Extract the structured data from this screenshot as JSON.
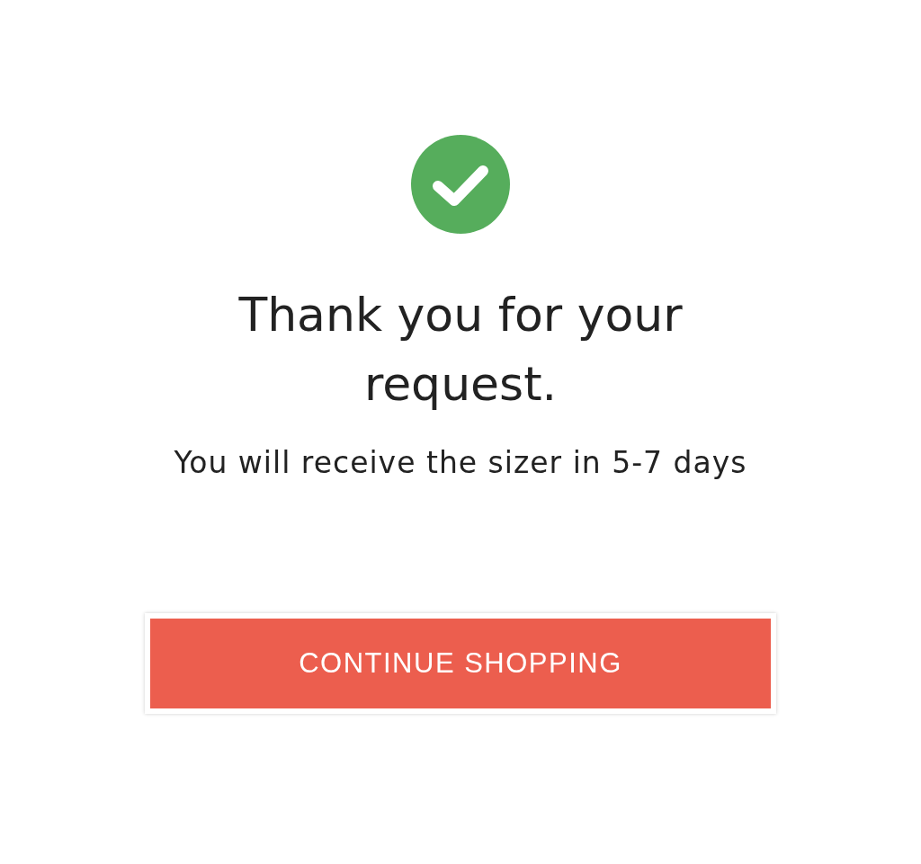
{
  "title": "Thank you for your request.",
  "message": "You will receive the sizer in 5-7 days",
  "button": {
    "label": "CONTINUE SHOPPING"
  }
}
